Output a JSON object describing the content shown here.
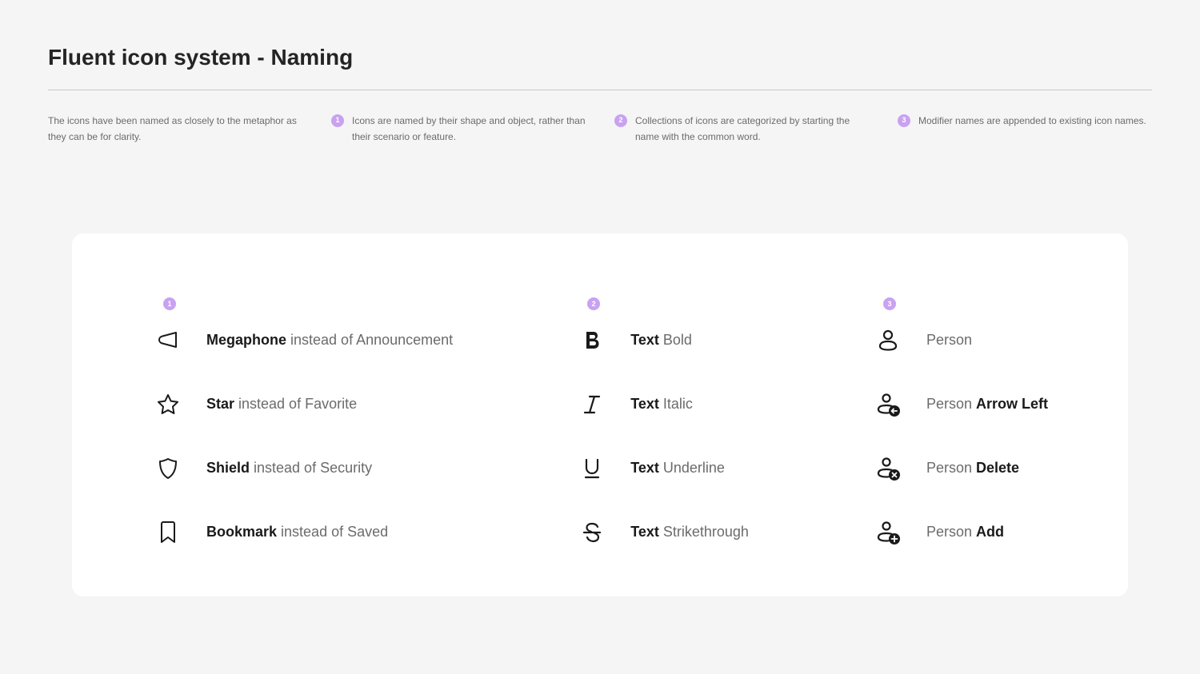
{
  "title": "Fluent icon system - Naming",
  "intro": "The icons have been named as closely to the metaphor as they can be for clarity.",
  "principles": [
    {
      "num": "1",
      "text": "Icons are named by their shape and object, rather than their scenario or feature."
    },
    {
      "num": "2",
      "text": "Collections of icons are categorized by starting the name with the common word."
    },
    {
      "num": "3",
      "text": "Modifier names are appended to existing icon names."
    }
  ],
  "cols": [
    {
      "num": "1",
      "items": [
        {
          "icon": "megaphone",
          "bold": "Megaphone",
          "rest": " instead of Announcement"
        },
        {
          "icon": "star",
          "bold": "Star",
          "rest": " instead of Favorite"
        },
        {
          "icon": "shield",
          "bold": "Shield",
          "rest": " instead of Security"
        },
        {
          "icon": "bookmark",
          "bold": "Bookmark",
          "rest": " instead of Saved"
        }
      ]
    },
    {
      "num": "2",
      "items": [
        {
          "icon": "bold",
          "pre": "Text ",
          "bold": "Bold"
        },
        {
          "icon": "italic",
          "pre": "Text ",
          "bold": "Italic"
        },
        {
          "icon": "underline",
          "pre": "Text ",
          "bold": "Underline"
        },
        {
          "icon": "strike",
          "pre": "Text ",
          "bold": "Strikethrough"
        }
      ]
    },
    {
      "num": "3",
      "items": [
        {
          "icon": "person",
          "pre": "Person"
        },
        {
          "icon": "person-left",
          "pre": "Person ",
          "bold": "Arrow Left"
        },
        {
          "icon": "person-delete",
          "pre": "Person ",
          "bold": "Delete"
        },
        {
          "icon": "person-add",
          "pre": "Person ",
          "bold": "Add"
        }
      ]
    }
  ]
}
